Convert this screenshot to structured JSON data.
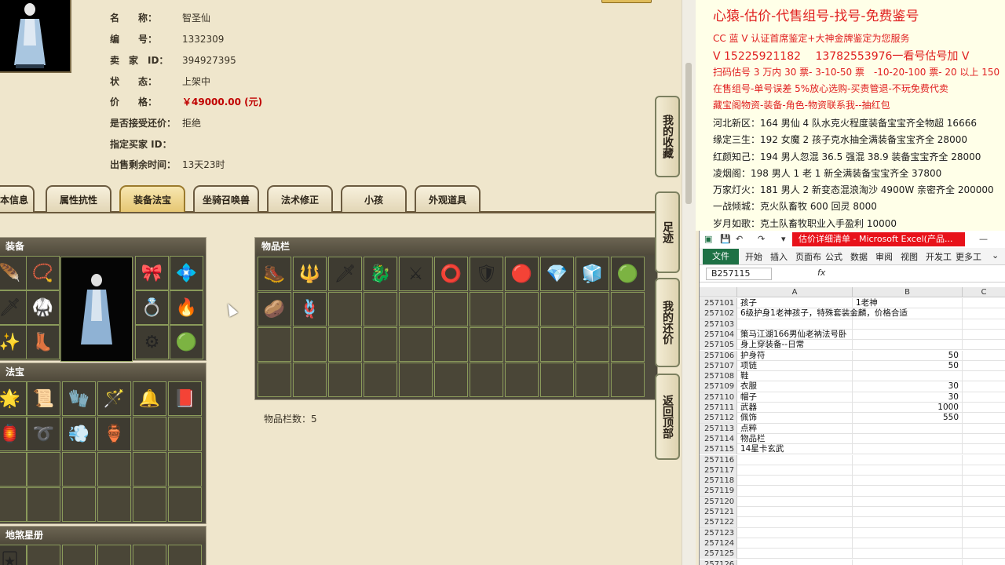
{
  "game": {
    "info": {
      "name_label": "名　　称：",
      "name_value": "智圣仙",
      "id_label": "编　　号：",
      "id_value": "1332309",
      "seller_label": "卖　家　ID：",
      "seller_value": "394927395",
      "status_label": "状　　态：",
      "status_value": "上架中",
      "price_label": "价　　格：",
      "price_value": "￥49000.00 (元)",
      "counter_label": "是否接受还价：",
      "counter_value": "拒绝",
      "buyer_label": "指定买家 ID：",
      "buyer_value": "",
      "remain_label": "出售剩余时间：",
      "remain_value": "13天23时"
    },
    "tabs": [
      "本信息",
      "属性抗性",
      "装备法宝",
      "坐骑召唤兽",
      "法术修正",
      "小孩",
      "外观道具"
    ],
    "active_tab": "装备法宝",
    "panels": {
      "equip": "装备",
      "treasure": "法宝",
      "star": "地煞星册",
      "bag": "物品栏"
    },
    "bag_count": "物品栏数：5",
    "side_nav": [
      "我的收藏",
      "足迹",
      "我的还价",
      "返回顶部"
    ]
  },
  "ad": {
    "title": "心猿-估价-代售组号-找号-免费鉴号",
    "lines": [
      {
        "text": "CC 蓝 V 认证首席鉴定+大神金牌鉴定为您服务",
        "style": "red"
      },
      {
        "text": "V 15225921182　 13782553976一看号估号加 V",
        "style": "redbig"
      },
      {
        "text": "扫码估号 3 万内 30 票- 3-10-50 票　-10-20-100 票- 20 以上 150",
        "style": "red"
      },
      {
        "text": "在售组号-单号误差 5%放心选购-买责管退-不玩免费代卖",
        "style": "red"
      },
      {
        "text": "藏宝阁物资-装备-角色-物资联系我--抽红包",
        "style": "red"
      },
      {
        "text": "河北新区：164 男仙 4 队水克火程度装备宝宝齐全物超 16666",
        "style": "dark"
      },
      {
        "text": "缘定三生：192 女魔 2 孩子克水抽全满装备宝宝齐全 28000",
        "style": "dark"
      },
      {
        "text": "红颜知己：194 男人忽混 36.5 强混 38.9 装备宝宝齐全 28000",
        "style": "dark"
      },
      {
        "text": "凌烟阁：198 男人 1 老 1 新全满装备宝宝齐全 37800",
        "style": "dark"
      },
      {
        "text": "万家灯火：181 男人 2 新变态混浪淘沙 4900W 亲密齐全 200000",
        "style": "dark"
      },
      {
        "text": "一战倾城：克火队畜牧 600 回灵 8000",
        "style": "dark"
      },
      {
        "text": "岁月如歌：克土队畜牧职业入手盈利 10000",
        "style": "dark"
      }
    ]
  },
  "excel": {
    "title": "估价详细清单 - Microsoft Excel(产品...",
    "ribbon_tabs": [
      "开始",
      "插入",
      "页面布",
      "公式",
      "数据",
      "审阅",
      "视图",
      "开发工",
      "更多工"
    ],
    "file_tab": "文件",
    "name_box": "B257115",
    "fx": "fx",
    "columns": [
      "A",
      "B",
      "C"
    ],
    "rows": [
      {
        "n": "257101",
        "a": "孩子",
        "b": "1老神",
        "num": false
      },
      {
        "n": "257102",
        "a": "6级护身1老神孩子，特殊套装金麟，价格合适",
        "b": "",
        "num": false
      },
      {
        "n": "257103",
        "a": "",
        "b": "",
        "num": false
      },
      {
        "n": "257104",
        "a": "策马江湖166男仙老衲法号卧",
        "b": "",
        "num": false
      },
      {
        "n": "257105",
        "a": "身上穿装备--日常",
        "b": "",
        "num": false
      },
      {
        "n": "257106",
        "a": "护身符",
        "b": "50",
        "num": true
      },
      {
        "n": "257107",
        "a": "项链",
        "b": "50",
        "num": true
      },
      {
        "n": "257108",
        "a": "鞋",
        "b": "",
        "num": true
      },
      {
        "n": "257109",
        "a": "衣服",
        "b": "30",
        "num": true
      },
      {
        "n": "257110",
        "a": "帽子",
        "b": "30",
        "num": true
      },
      {
        "n": "257111",
        "a": "武器",
        "b": "1000",
        "num": true
      },
      {
        "n": "257112",
        "a": "佩饰",
        "b": "550",
        "num": true
      },
      {
        "n": "257113",
        "a": "点粹",
        "b": "",
        "num": false
      },
      {
        "n": "257114",
        "a": "物品栏",
        "b": "",
        "num": false
      },
      {
        "n": "257115",
        "a": "14星卡玄武",
        "b": "",
        "num": false
      },
      {
        "n": "257116",
        "a": "",
        "b": "",
        "num": false
      },
      {
        "n": "257117",
        "a": "",
        "b": "",
        "num": false
      },
      {
        "n": "257118",
        "a": "",
        "b": "",
        "num": false
      },
      {
        "n": "257119",
        "a": "",
        "b": "",
        "num": false
      },
      {
        "n": "257120",
        "a": "",
        "b": "",
        "num": false
      },
      {
        "n": "257121",
        "a": "",
        "b": "",
        "num": false
      },
      {
        "n": "257122",
        "a": "",
        "b": "",
        "num": false
      },
      {
        "n": "257123",
        "a": "",
        "b": "",
        "num": false
      },
      {
        "n": "257124",
        "a": "",
        "b": "",
        "num": false
      },
      {
        "n": "257125",
        "a": "",
        "b": "",
        "num": false
      },
      {
        "n": "257126",
        "a": "",
        "b": "",
        "num": false
      }
    ]
  },
  "colors": {
    "ad_red": "#e02020",
    "excel_green": "#1e7145",
    "title_red": "#e8121a",
    "price_red": "#c00000"
  }
}
